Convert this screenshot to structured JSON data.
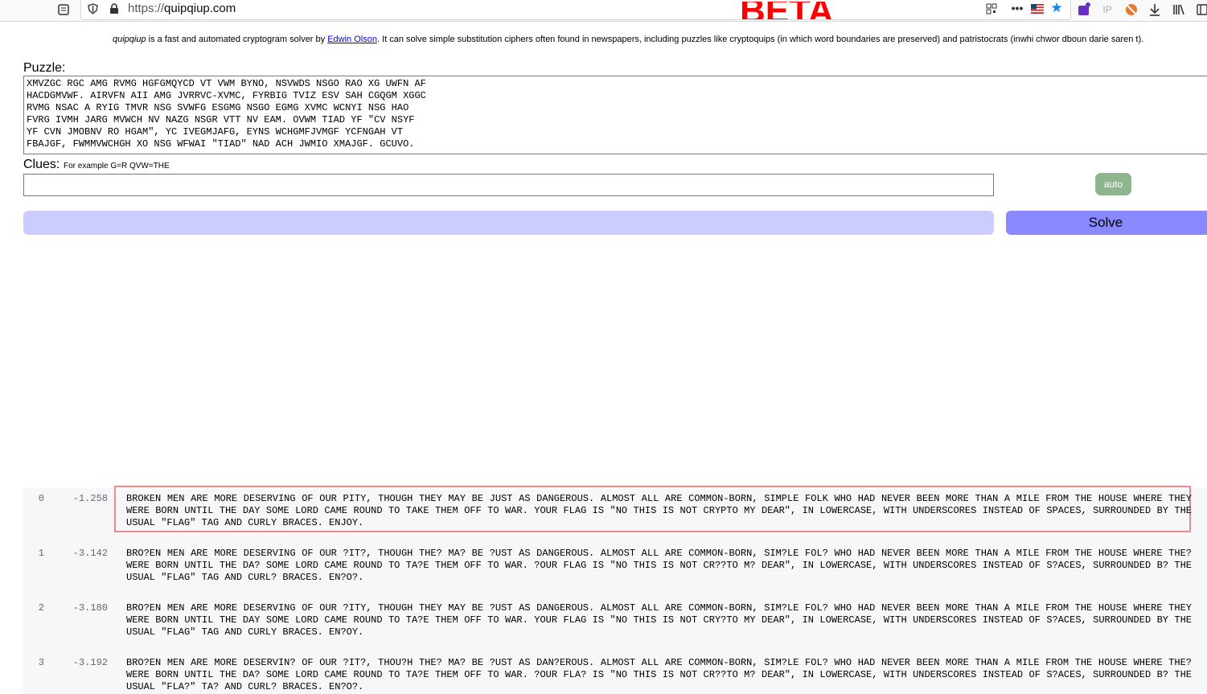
{
  "browser": {
    "url_scheme": "https://",
    "url_host": "quipqiup.com"
  },
  "page": {
    "beta_label": "BETA",
    "intro": {
      "site_name": "quipqiup",
      "text_before_link": " is a fast and automated cryptogram solver by ",
      "author_link": "Edwin Olson",
      "text_after_link": ". It can solve simple substitution ciphers often found in newspapers, including puzzles like cryptoquips (in which word boundaries are preserved) and patristocrats (inwhi chwor dboun darie saren t)."
    },
    "puzzle_label": "Puzzle:",
    "puzzle_text": "XMVZGC RGC AMG RVMG HGFGMQYCD VT VWM BYNO, NSVWDS NSGO RAO XG UWFN AF\nHACDGMVWF. AIRVFN AII AMG JVRRVC-XVMC, FYRBIG TVIZ ESV SAH CGQGM XGGC\nRVMG NSAC A RYIG TMVR NSG SVWFG ESGMG NSGO EGMG XVMC WCNYI NSG HAO\nFVRG IVMH JARG MVWCH NV NAZG NSGR VTT NV EAM. OVWM TIAD YF \"CV NSYF\nYF CVN JMOBNV RO HGAM\", YC IVEGMJAFG, EYNS WCHGMFJVMGF YCFNGAH VT\nFBAJGF, FWMMVWCHGH XO NSG WFWAI \"TIAD\" NAD ACH JWMIO XMAJGF. GCUVO.",
    "clues_label": "Clues:",
    "clues_hint": "For example G=R QVW=THE",
    "clues_value": "",
    "auto_label": "auto",
    "solve_label": "Solve"
  },
  "results": [
    {
      "index": "0",
      "score": "-1.258",
      "text": "BROKEN MEN ARE MORE DESERVING OF OUR PITY, THOUGH THEY MAY BE JUST AS DANGEROUS. ALMOST ALL ARE COMMON-BORN, SIMPLE FOLK WHO HAD NEVER BEEN MORE THAN A MILE FROM THE HOUSE WHERE THEY WERE BORN UNTIL THE DAY SOME LORD CAME ROUND TO TAKE THEM OFF TO WAR. YOUR FLAG IS \"NO THIS IS NOT CRYPTO MY DEAR\", IN LOWERCASE, WITH UNDERSCORES INSTEAD OF SPACES, SURROUNDED BY THE USUAL \"FLAG\" TAG AND CURLY BRACES. ENJOY."
    },
    {
      "index": "1",
      "score": "-3.142",
      "text": "BRO?EN MEN ARE MORE DESERVING OF OUR ?IT?, THOUGH THE? MA? BE ?UST AS DANGEROUS. ALMOST ALL ARE COMMON-BORN, SIM?LE FOL? WHO HAD NEVER BEEN MORE THAN A MILE FROM THE HOUSE WHERE THE? WERE BORN UNTIL THE DA? SOME LORD CAME ROUND TO TA?E THEM OFF TO WAR. ?OUR FLAG IS \"NO THIS IS NOT CR??TO M? DEAR\", IN LOWERCASE, WITH UNDERSCORES INSTEAD OF S?ACES, SURROUNDED B? THE USUAL \"FLAG\" TAG AND CURL? BRACES. EN?O?."
    },
    {
      "index": "2",
      "score": "-3.180",
      "text": "BRO?EN MEN ARE MORE DESERVING OF OUR ?ITY, THOUGH THEY MAY BE ?UST AS DANGEROUS. ALMOST ALL ARE COMMON-BORN, SIM?LE FOL? WHO HAD NEVER BEEN MORE THAN A MILE FROM THE HOUSE WHERE THEY WERE BORN UNTIL THE DAY SOME LORD CAME ROUND TO TA?E THEM OFF TO WAR. YOUR FLAG IS \"NO THIS IS NOT CRY?TO MY DEAR\", IN LOWERCASE, WITH UNDERSCORES INSTEAD OF S?ACES, SURROUNDED BY THE USUAL \"FLAG\" TAG AND CURLY BRACES. EN?OY."
    },
    {
      "index": "3",
      "score": "-3.192",
      "text": "BRO?EN MEN ARE MORE DESERVIN? OF OUR ?IT?, THOU?H THE? MA? BE ?UST AS DAN?EROUS. ALMOST ALL ARE COMMON-BORN, SIM?LE FOL? WHO HAD NEVER BEEN MORE THAN A MILE FROM THE HOUSE WHERE THE? WERE BORN UNTIL THE DA? SOME LORD CAME ROUND TO TA?E THEM OFF TO WAR. ?OUR FLA? IS \"NO THIS IS NOT CR??TO M? DEAR\", IN LOWERCASE, WITH UNDERSCORES INSTEAD OF S?ACES, SURROUNDED B? THE USUAL \"FLA?\" TA? AND CURL? BRACES. EN?O?."
    }
  ]
}
